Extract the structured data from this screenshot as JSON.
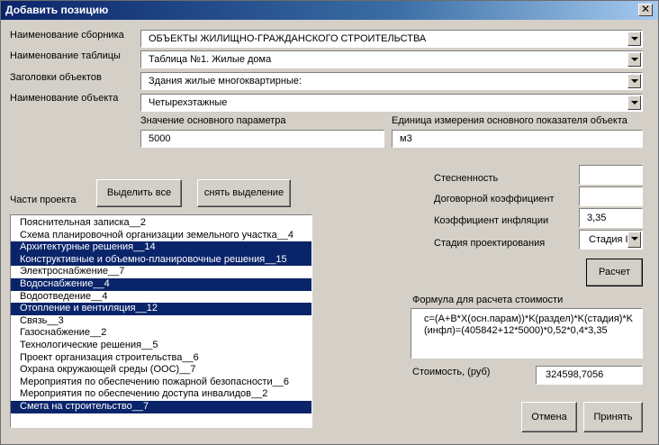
{
  "window": {
    "title": "Добавить позицию",
    "close_glyph": "✕"
  },
  "fields": {
    "collection": {
      "label": "Наименование сборника",
      "value": "ОБЪЕКТЫ ЖИЛИЩНО-ГРАЖДАНСКОГО СТРОИТЕЛЬСТВА"
    },
    "table": {
      "label": "Наименование таблицы",
      "value": "Таблица №1.  Жилые дома"
    },
    "headers": {
      "label": "Заголовки объектов",
      "value": "Здания жилые многоквартирные:"
    },
    "object": {
      "label": "Наименование объекта",
      "value": "Четырехэтажные"
    },
    "main_param": {
      "label": "Значение основного параметра",
      "value": "5000"
    },
    "unit": {
      "label": "Единица измерения основного показателя объекта",
      "value": "м3"
    }
  },
  "parts": {
    "label": "Части проекта",
    "select_all": "Выделить все",
    "deselect": "снять выделение",
    "items": [
      {
        "text": "Пояснительная записка__2",
        "selected": false
      },
      {
        "text": "Схема планировочной  организации земельного участка__4",
        "selected": false
      },
      {
        "text": "Архитектурные решения__14",
        "selected": true
      },
      {
        "text": "Конструктивные и объемно-планировочные решения__15",
        "selected": true
      },
      {
        "text": "Электроснабжение__7",
        "selected": false
      },
      {
        "text": "Водоснабжение__4",
        "selected": true
      },
      {
        "text": "Водоотведение__4",
        "selected": false
      },
      {
        "text": "Отопление и вентиляция__12",
        "selected": true
      },
      {
        "text": "Связь__3",
        "selected": false
      },
      {
        "text": "Газоснабжение__2",
        "selected": false
      },
      {
        "text": "Технологические решения__5",
        "selected": false
      },
      {
        "text": "Проект организация строительства__6",
        "selected": false
      },
      {
        "text": "Охрана окружающей среды (ООС)__7",
        "selected": false
      },
      {
        "text": "Мероприятия по обеспечению пожарной безопасности__6",
        "selected": false
      },
      {
        "text": "Мероприятия по обеспечению доступа инвалидов__2",
        "selected": false
      },
      {
        "text": "Смета на строительство__7",
        "selected": true
      }
    ]
  },
  "coefficients": {
    "constraint": {
      "label": "Стесненность",
      "value": ""
    },
    "contract": {
      "label": "Договорной коэффициент",
      "value": ""
    },
    "inflation": {
      "label": "Коэффициент инфляции",
      "value": "3,35"
    },
    "stage": {
      "label": "Стадия проектирования",
      "value": "Стадия I"
    }
  },
  "calc_button": "Расчет",
  "formula": {
    "label": "Формула для расчета стоимости",
    "line1": "c=(A+B*X(осн.парам))*K(раздел)*K(стадия)*K",
    "line2": "(инфл)=(405842+12*5000)*0,52*0,4*3,35"
  },
  "cost": {
    "label": "Стоимость, (руб)",
    "value": "324598,7056"
  },
  "buttons": {
    "cancel": "Отмена",
    "accept": "Принять"
  }
}
